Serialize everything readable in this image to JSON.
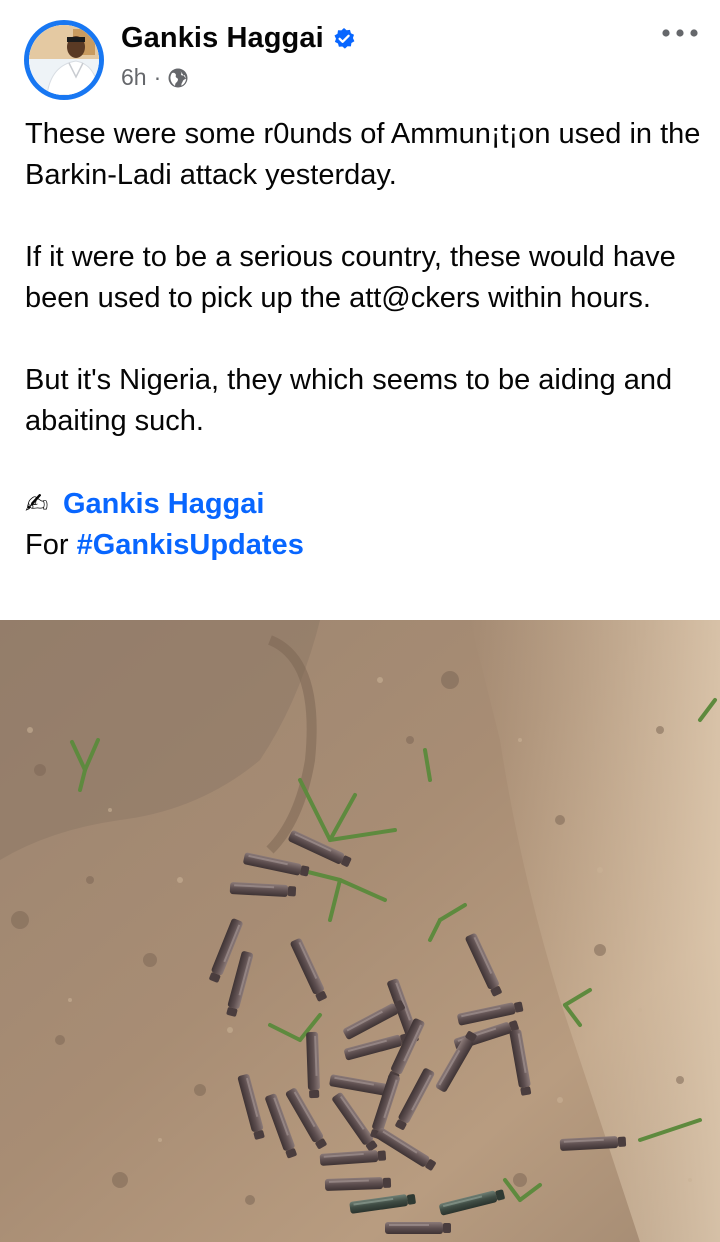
{
  "post": {
    "author": {
      "name": "Gankis Haggai",
      "verified_icon": "verified-badge-icon",
      "avatar_icon": "profile-avatar"
    },
    "meta": {
      "time": "6h",
      "separator": "·",
      "audience_icon": "globe-icon"
    },
    "more_icon": "more-options-icon",
    "paragraphs": [
      "These were some r0unds of Ammun¡t¡on used in the Barkin-Ladi attack yesterday.",
      "If it were to be a serious country, these would have been used to pick up the att@ckers within hours.",
      "But it's Nigeria, they which seems to be aiding and abaiting such."
    ],
    "signature": {
      "pen_emoji": "✍",
      "author_link": "Gankis Haggai",
      "for_label": "For",
      "hashtag": "#GankisUpdates"
    },
    "photo": {
      "subject": "spent-cartridge-casings-on-dirt-ground"
    }
  },
  "colors": {
    "link": "#0866ff",
    "verified": "#0866ff",
    "meta_gray": "#65676b",
    "avatar_ring": "#1877f2"
  }
}
